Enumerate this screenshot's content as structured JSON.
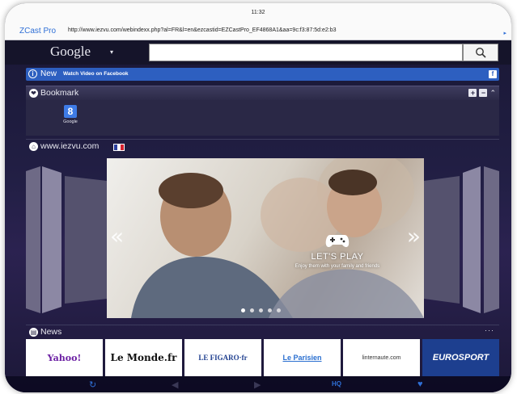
{
  "status": {
    "time": "11:32"
  },
  "browser": {
    "app_name": "ZCast Pro",
    "url": "http://www.iezvu.com/webindexx.php?al=FR&l=en&ezcastid=EZCastPro_EF4868A1&aa=9c:f3:87:5d:e2:b3"
  },
  "search": {
    "brand": "Google",
    "caret": "▾",
    "value": ""
  },
  "new_bar": {
    "label": "New",
    "link": "Watch Video on Facebook",
    "fb_glyph": "f"
  },
  "bookmark": {
    "label": "Bookmark",
    "items": [
      {
        "name": "Google",
        "glyph": "8"
      }
    ]
  },
  "site": {
    "label": "www.iezvu.com",
    "flag_colors": [
      "#2a3f9d",
      "#ffffff",
      "#d5212f"
    ]
  },
  "slide": {
    "title": "LET'S PLAY",
    "subtitle": "Enjoy them with your family and friends",
    "dots": 5,
    "active_dot": 0
  },
  "news": {
    "label": "News",
    "more": "···",
    "sources": [
      {
        "name": "Yahoo!",
        "color": "#6b1fa3"
      },
      {
        "name": "Le Monde.fr",
        "color": "#111111"
      },
      {
        "name": "LE FIGARO·fr",
        "color": "#1f3f8f"
      },
      {
        "name": "Le Parisien",
        "color": "#2a6fd0"
      },
      {
        "name": "linternaute.com",
        "color": "#333333"
      },
      {
        "name": "EUROSPORT",
        "color": "#1d3f8f"
      }
    ]
  },
  "toolbar": {
    "hq_label": "HQ"
  },
  "colors": {
    "accent": "#2f6fd6",
    "new_bar": "#2d5fc0",
    "background": "#1a1836"
  }
}
